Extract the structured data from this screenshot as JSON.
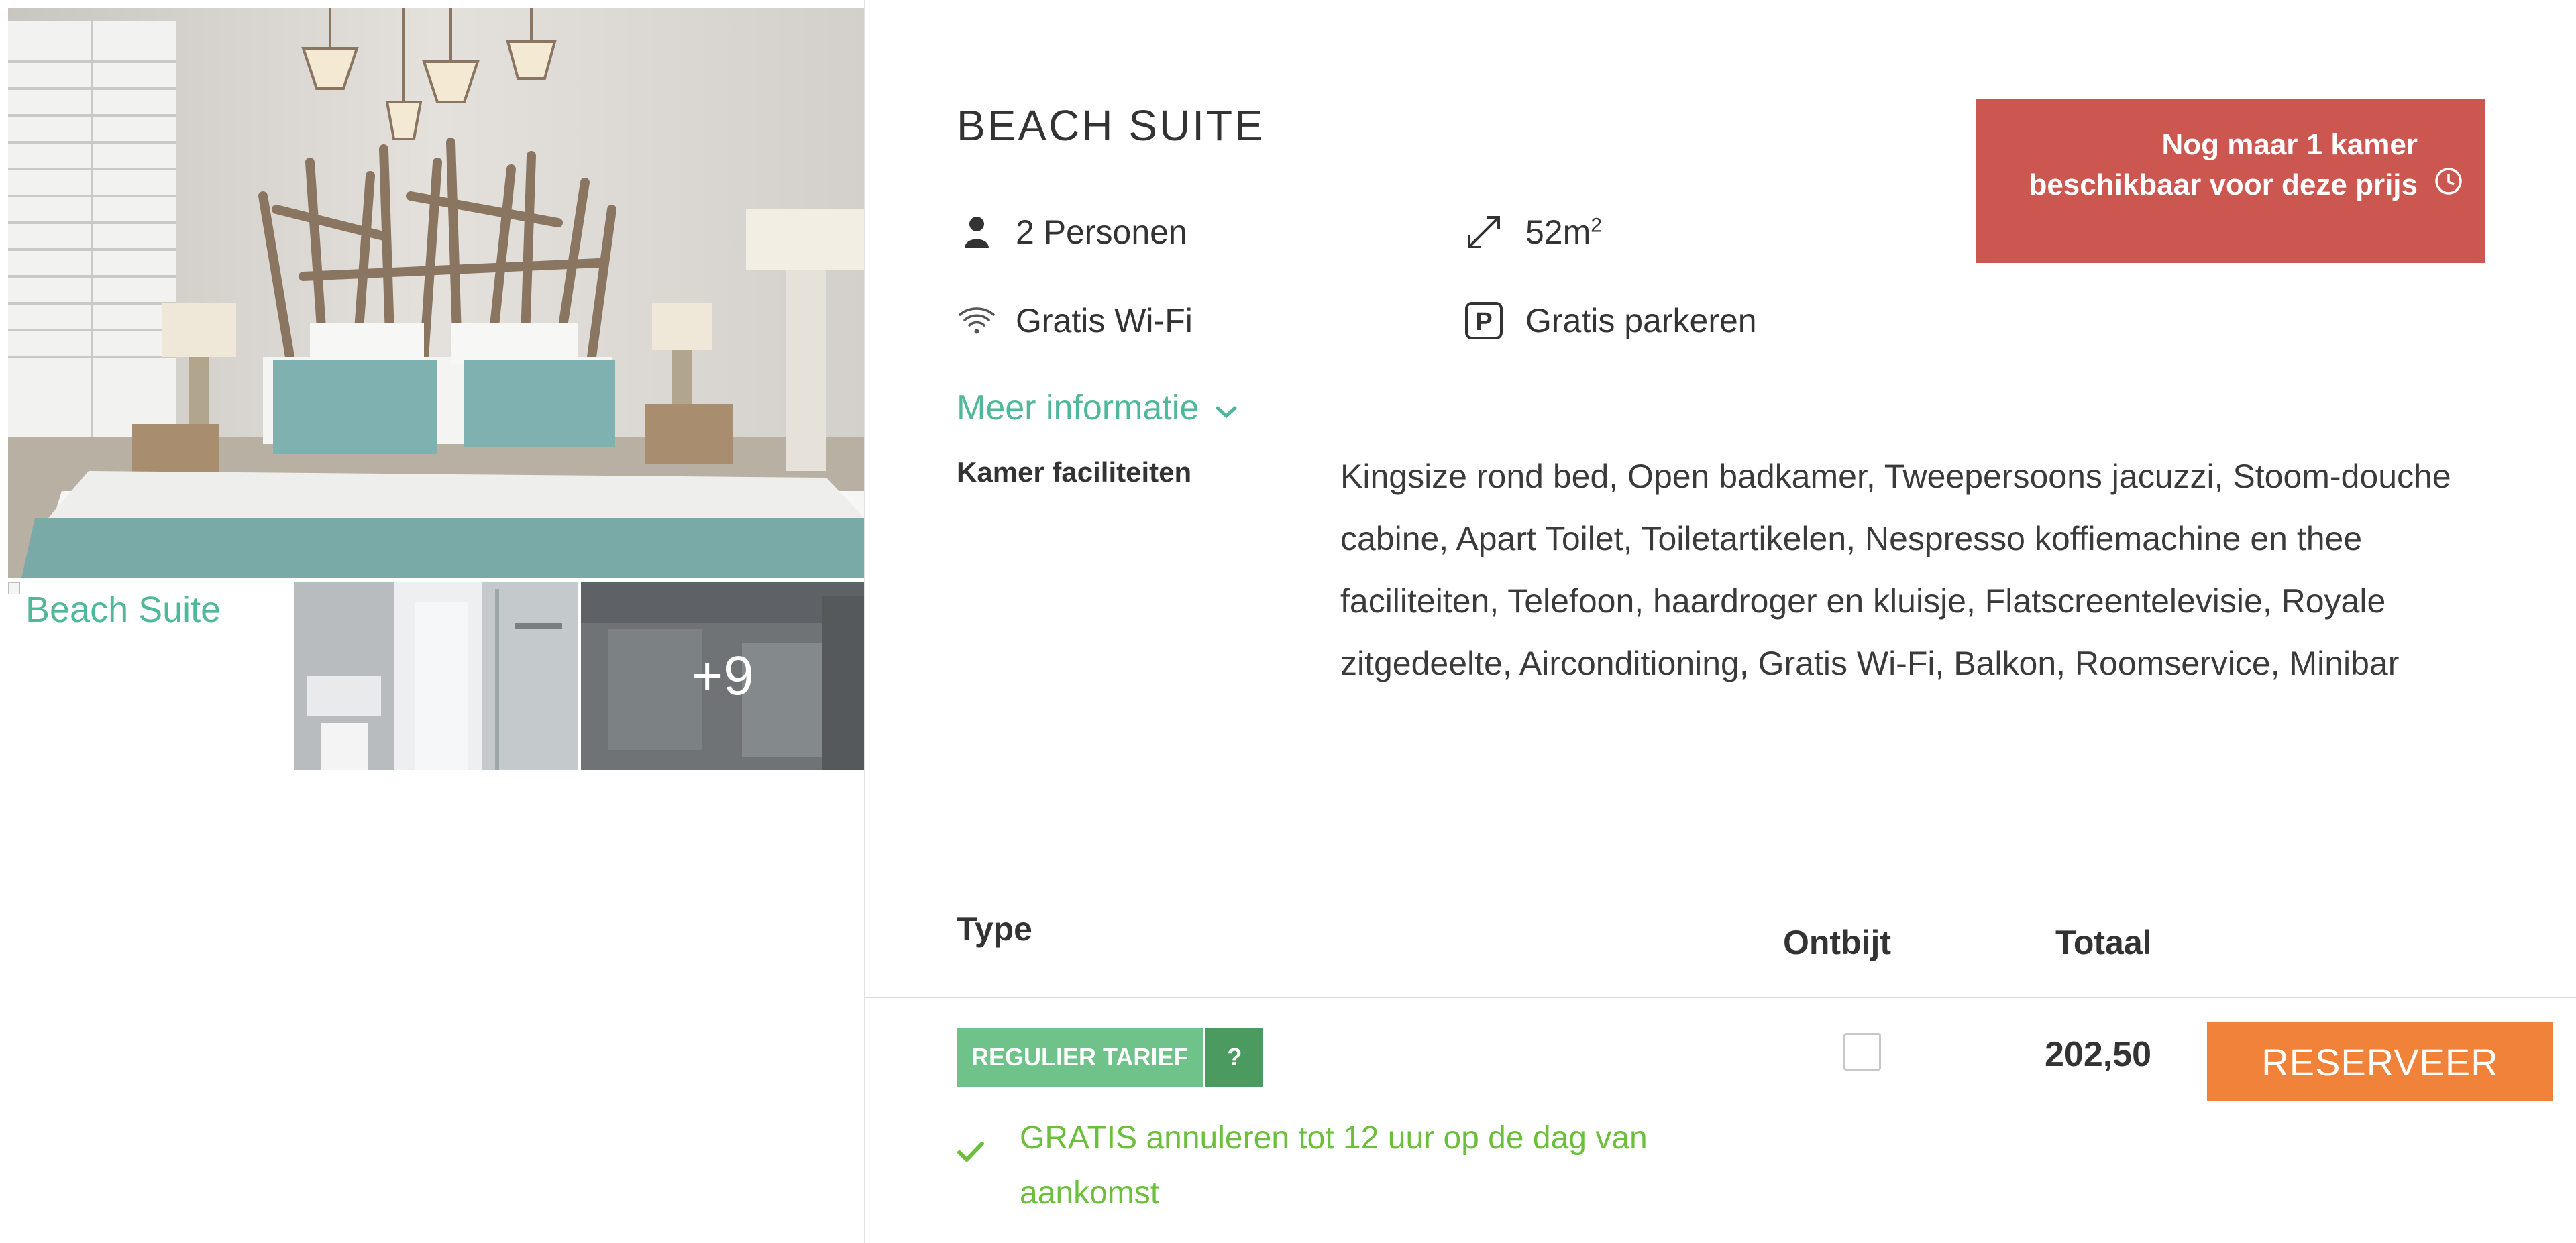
{
  "room": {
    "title": "BEACH SUITE",
    "features": {
      "persons": "2 Personen",
      "size_value": "52m",
      "size_sup": "2",
      "wifi": "Gratis Wi-Fi",
      "parking": "Gratis parkeren"
    },
    "availability_badge": "Nog maar 1 kamer beschikbaar voor deze prijs",
    "more_info": "Meer informatie",
    "facilities_label": "Kamer faciliteiten",
    "facilities_text": "Kingsize rond bed, Open badkamer, Tweepersoons jacuzzi, Stoom-douche cabine, Apart Toilet, Toiletartikelen, Nespresso koffiemachine en thee faciliteiten, Telefoon, haardroger en kluisje, Flatscreentelevisie, Royale zitgedeelte, Airconditioning, Gratis Wi-Fi, Balkon, Roomservice, Minibar"
  },
  "gallery": {
    "broken_image_alt": "Beach Suite",
    "more_count": "+9"
  },
  "table": {
    "headers": {
      "type": "Type",
      "ontbijt": "Ontbijt",
      "totaal": "Totaal"
    },
    "rate": {
      "name": "REGULIER TARIEF",
      "help": "?",
      "breakfast_checked": false,
      "price": "202,50",
      "reserve_label": "RESERVEER",
      "cancellation": "GRATIS annuleren tot 12 uur op de dag van aankomst"
    }
  },
  "colors": {
    "accent_green": "#4fb89a",
    "badge_red": "#cc5650",
    "rate_green": "#6fc28a",
    "rate_dark_green": "#4b9b61",
    "reserve_orange": "#f08239",
    "cancel_green": "#6cbf3b"
  },
  "icons": {
    "persons": "person-icon",
    "size": "expand-arrows-icon",
    "wifi": "wifi-icon",
    "parking": "parking-icon",
    "badge": "clock-icon",
    "more_info": "chevron-down-icon",
    "cancellation": "checkmark-icon"
  }
}
